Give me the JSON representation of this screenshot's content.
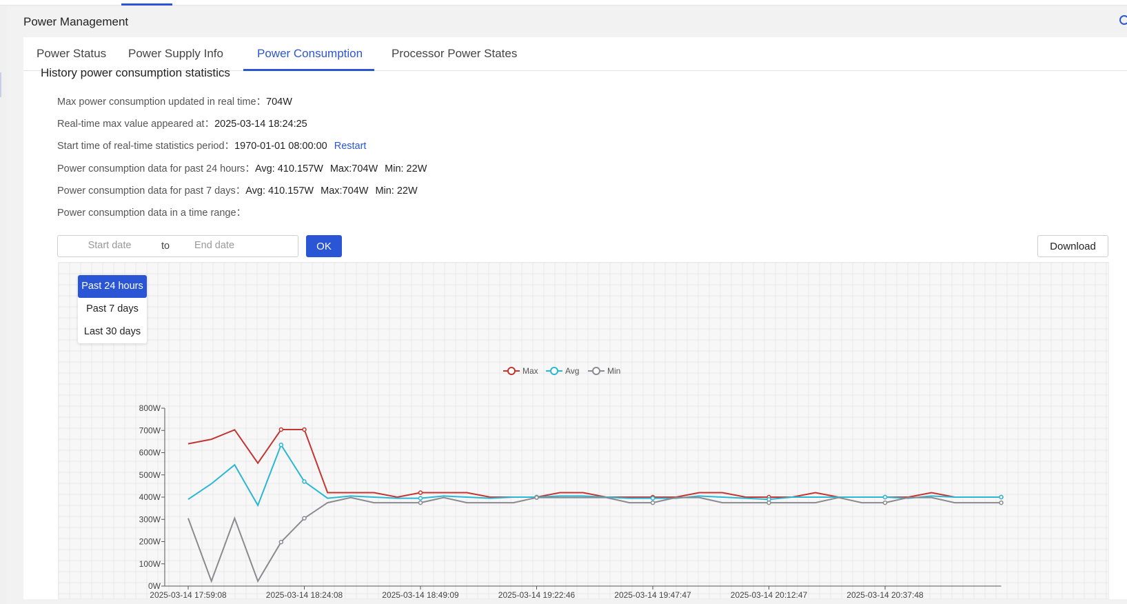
{
  "page_title": "Power Management",
  "tabs": [
    {
      "label": "Power Status",
      "active": false
    },
    {
      "label": "Power Supply Info",
      "active": false
    },
    {
      "label": "Power Consumption",
      "active": true
    },
    {
      "label": "Processor Power States",
      "active": false
    }
  ],
  "section_title": "History power consumption statistics",
  "info": {
    "max_label": "Max power consumption updated in real time：",
    "max_value": "704W",
    "max_time_label": "Real-time max value appeared at：",
    "max_time_value": "2025-03-14 18:24:25",
    "start_label": "Start time of real-time statistics period：",
    "start_value": "1970-01-01 08:00:00",
    "restart_label": "Restart",
    "past24_label": "Power consumption data for past 24 hours：",
    "past24_avg": "Avg: 410.157W",
    "past24_max": "Max:704W",
    "past24_min": "Min: 22W",
    "past7_label": "Power consumption data for past 7 days：",
    "past7_avg": "Avg: 410.157W",
    "past7_max": "Max:704W",
    "past7_min": "Min: 22W",
    "range_label": "Power consumption data in a time range："
  },
  "date_range": {
    "start_placeholder": "Start date",
    "to_label": "to",
    "end_placeholder": "End date"
  },
  "ok_label": "OK",
  "download_label": "Download",
  "range_options": [
    {
      "label": "Past 24 hours",
      "active": true
    },
    {
      "label": "Past 7 days",
      "active": false
    },
    {
      "label": "Last 30 days",
      "active": false
    }
  ],
  "colors": {
    "accent": "#2a56d6",
    "max": "#c23531",
    "avg": "#2ab7d3",
    "min": "#8a8a8f"
  },
  "chart_data": {
    "type": "line",
    "legend_position": "top-center",
    "grid": true,
    "y_unit": "W",
    "ylim": [
      0,
      800
    ],
    "y_ticks": [
      "0W",
      "100W",
      "200W",
      "300W",
      "400W",
      "500W",
      "600W",
      "700W",
      "800W"
    ],
    "x_tick_labels": [
      "2025-03-14 17:59:08",
      "2025-03-14 18:24:08",
      "2025-03-14 18:49:09",
      "2025-03-14 19:22:46",
      "2025-03-14 19:47:47",
      "2025-03-14 20:12:47",
      "2025-03-14 20:37:48"
    ],
    "x_tick_every": 5,
    "series": [
      {
        "name": "Max",
        "values": [
          640,
          660,
          703,
          553,
          704,
          704,
          420,
          420,
          420,
          400,
          420,
          420,
          420,
          400,
          400,
          400,
          420,
          420,
          400,
          400,
          400,
          400,
          420,
          420,
          400,
          400,
          400,
          420,
          400,
          400,
          400,
          400,
          420,
          400,
          400,
          400
        ]
      },
      {
        "name": "Avg",
        "values": [
          390,
          460,
          545,
          363,
          635,
          470,
          395,
          405,
          400,
          395,
          395,
          405,
          400,
          395,
          400,
          400,
          405,
          405,
          400,
          395,
          395,
          395,
          405,
          400,
          395,
          390,
          400,
          400,
          400,
          400,
          400,
          395,
          405,
          400,
          400,
          400
        ]
      },
      {
        "name": "Min",
        "values": [
          305,
          22,
          305,
          22,
          198,
          305,
          375,
          398,
          375,
          375,
          375,
          398,
          375,
          375,
          375,
          398,
          398,
          398,
          398,
          375,
          375,
          398,
          398,
          375,
          375,
          375,
          375,
          375,
          398,
          375,
          375,
          398,
          398,
          375,
          375,
          375
        ]
      }
    ]
  }
}
